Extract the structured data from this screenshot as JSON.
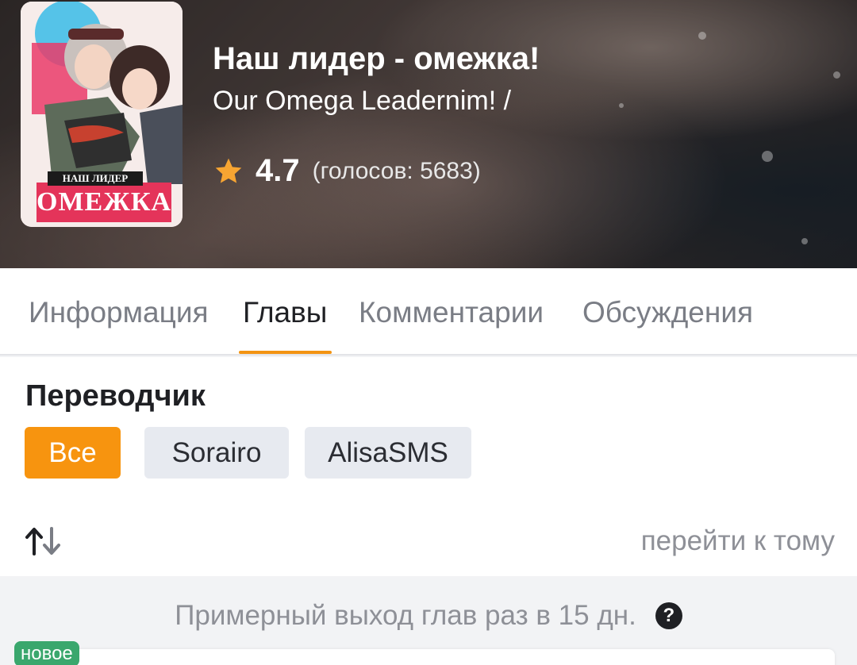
{
  "header": {
    "title": "Наш лидер - омежка!",
    "subtitle": "Our Omega Leadernim! /",
    "rating": {
      "value": "4.7",
      "votes": "(голосов: 5683)",
      "star_icon": "star-icon",
      "star_color": "#f7a532"
    },
    "cover": {
      "caption_top": "НАШ ЛИДЕР",
      "caption_main": "ОМЕЖКА"
    }
  },
  "tabs": [
    {
      "label": "Информация",
      "active": false
    },
    {
      "label": "Главы",
      "active": true
    },
    {
      "label": "Комментарии",
      "active": false
    },
    {
      "label": "Обсуждения",
      "active": false
    }
  ],
  "translator": {
    "title": "Переводчик",
    "options": [
      {
        "label": "Все",
        "active": true
      },
      {
        "label": "Sorairo",
        "active": false
      },
      {
        "label": "AlisaSMS",
        "active": false
      }
    ]
  },
  "toolbar": {
    "sort_icon": "sort-arrows-icon",
    "goto_volume": "перейти к тому"
  },
  "release_info": {
    "text": "Примерный выход глав раз в 15 дн.",
    "help_icon": "question-icon",
    "help_glyph": "?"
  },
  "chapter_list": {
    "new_badge": "новое"
  },
  "colors": {
    "accent": "#f7940f",
    "tab_underline": "#f39412",
    "new_badge": "#3aa76d"
  }
}
